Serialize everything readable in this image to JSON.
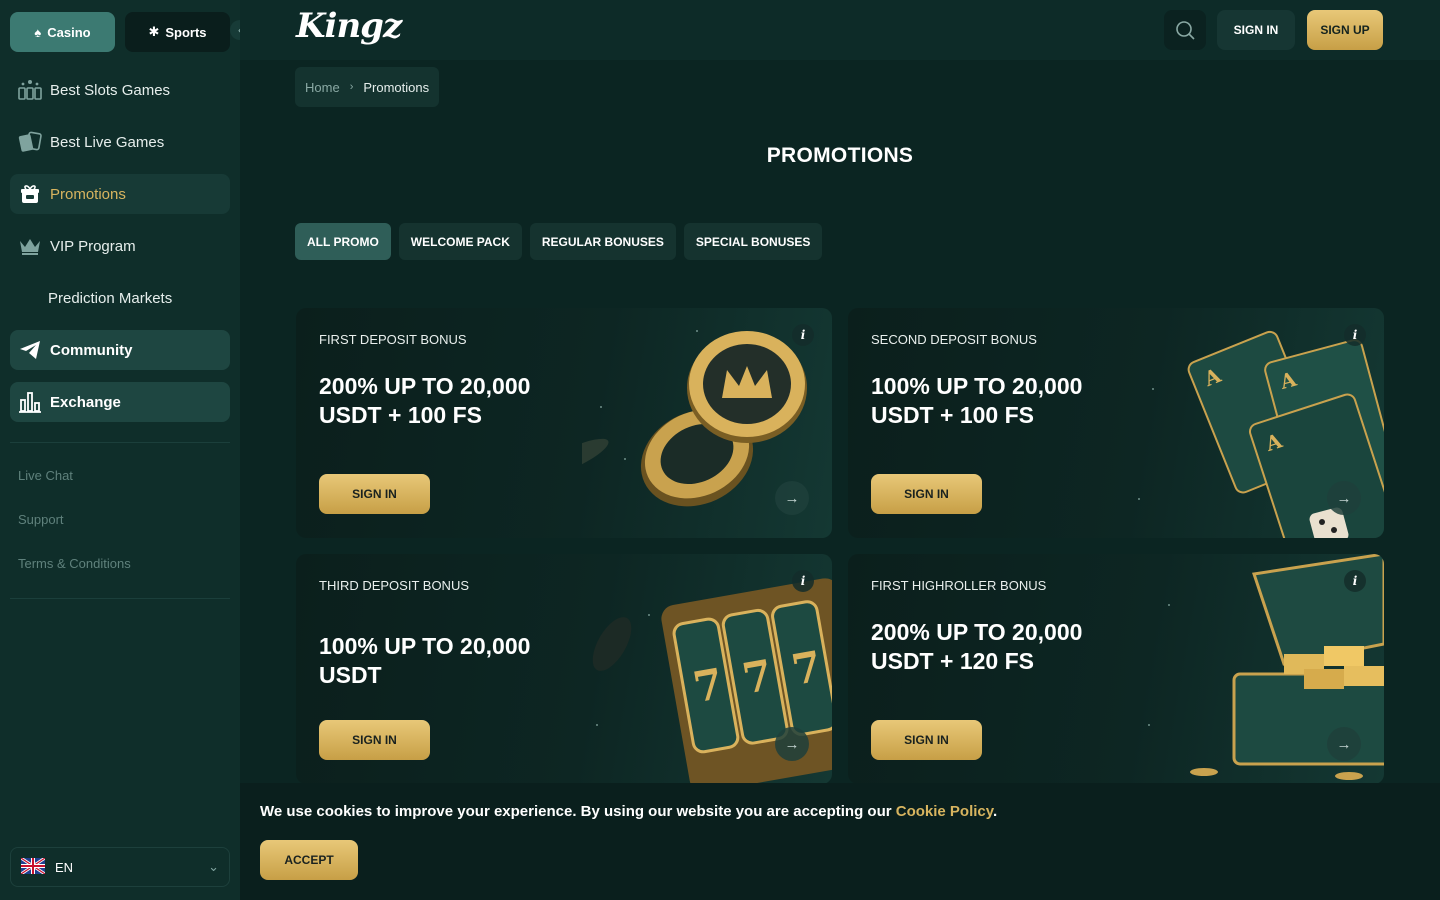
{
  "sidebar": {
    "tabs": [
      {
        "label": "Casino",
        "icon": "spade-icon"
      },
      {
        "label": "Sports",
        "icon": "ball-icon"
      }
    ],
    "items": [
      {
        "label": "Best Slots Games",
        "icon": "slots-icon"
      },
      {
        "label": "Best Live Games",
        "icon": "cards-icon"
      },
      {
        "label": "Promotions",
        "icon": "gift-icon",
        "active": true
      },
      {
        "label": "VIP Program",
        "icon": "crown-icon"
      },
      {
        "label": "Prediction Markets",
        "icon": ""
      },
      {
        "label": "Community",
        "icon": "telegram-icon"
      },
      {
        "label": "Exchange",
        "icon": "chart-icon"
      }
    ],
    "footer_links": [
      "Live Chat",
      "Support",
      "Terms & Conditions"
    ],
    "language": "EN"
  },
  "header": {
    "logo": "Kingz",
    "signin": "SIGN IN",
    "signup": "SIGN UP"
  },
  "breadcrumb": {
    "home": "Home",
    "current": "Promotions"
  },
  "page_title": "PROMOTIONS",
  "filters": [
    "ALL PROMO",
    "WELCOME PACK",
    "REGULAR BONUSES",
    "SPECIAL BONUSES"
  ],
  "promos": [
    {
      "label": "FIRST DEPOSIT BONUS",
      "headline": "200% UP TO 20,000 USDT + 100 FS",
      "cta": "SIGN IN",
      "art": "coins"
    },
    {
      "label": "SECOND DEPOSIT BONUS",
      "headline": "100% UP TO 20,000 USDT + 100 FS",
      "cta": "SIGN IN",
      "art": "cards"
    },
    {
      "label": "THIRD DEPOSIT BONUS",
      "headline": "100% UP TO 20,000 USDT",
      "cta": "SIGN IN",
      "art": "slot"
    },
    {
      "label": "FIRST HIGHROLLER BONUS",
      "headline": "200% UP TO 20,000 USDT + 120 FS",
      "cta": "SIGN IN",
      "art": "chest"
    }
  ],
  "cookie": {
    "message": "We use cookies to improve your experience. By using our website you are accepting our",
    "link": "Cookie Policy",
    "period": ".",
    "accept": "ACCEPT"
  },
  "colors": {
    "accent_gold": "#d7b45f",
    "background": "#0b2522",
    "sidebar": "#0f2e2a"
  }
}
